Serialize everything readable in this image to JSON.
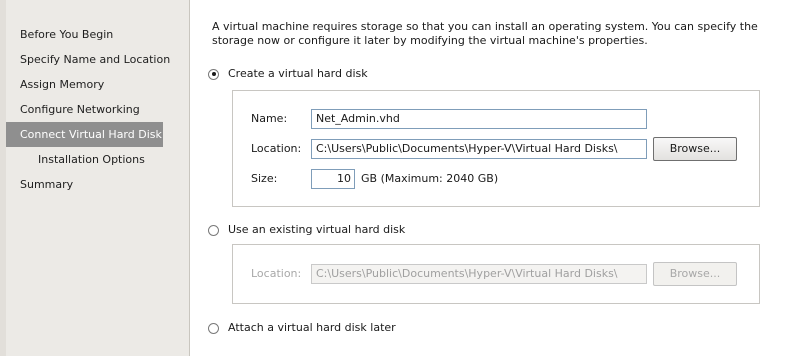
{
  "sidebar": {
    "items": [
      {
        "label": "Before You Begin"
      },
      {
        "label": "Specify Name and Location"
      },
      {
        "label": "Assign Memory"
      },
      {
        "label": "Configure Networking"
      },
      {
        "label": "Connect Virtual Hard Disk",
        "selected": true
      },
      {
        "label": "Installation Options",
        "sub": true
      },
      {
        "label": "Summary"
      }
    ]
  },
  "main": {
    "description": "A virtual machine requires storage so that you can install an operating system. You can specify the storage now or configure it later by modifying the virtual machine's properties.",
    "create": {
      "label": "Create a virtual hard disk",
      "selected": true,
      "name_label": "Name:",
      "name_value": "Net_Admin.vhd",
      "location_label": "Location:",
      "location_value": "C:\\Users\\Public\\Documents\\Hyper-V\\Virtual Hard Disks\\",
      "browse_label": "Browse...",
      "size_label": "Size:",
      "size_value": "10",
      "size_suffix": "GB (Maximum: 2040 GB)"
    },
    "existing": {
      "label": "Use an existing virtual hard disk",
      "selected": false,
      "location_label": "Location:",
      "location_value": "C:\\Users\\Public\\Documents\\Hyper-V\\Virtual Hard Disks\\",
      "browse_label": "Browse..."
    },
    "later": {
      "label": "Attach a virtual hard disk later",
      "selected": false
    }
  }
}
